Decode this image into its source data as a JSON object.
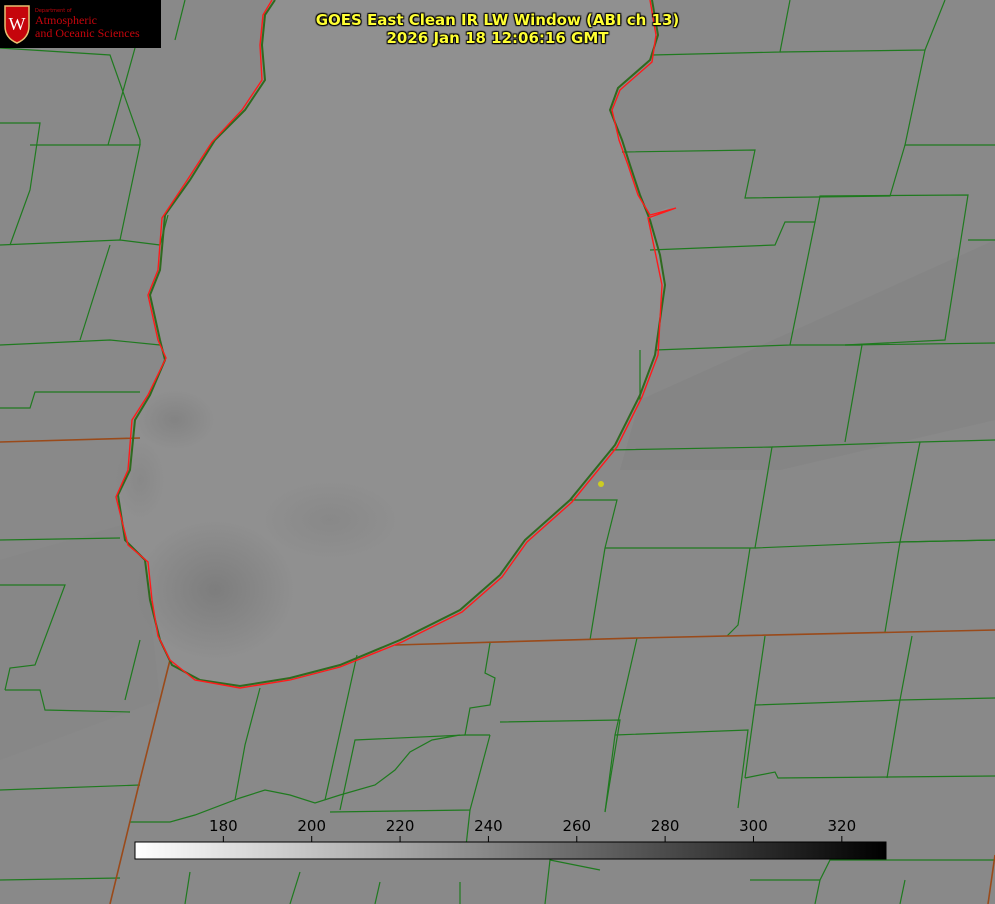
{
  "title": {
    "line1": "GOES East Clean IR LW Window (ABI ch 13)",
    "line2": "2026 Jan 18 12:06:16 GMT"
  },
  "logo": {
    "dept": "Department of",
    "line1": "Atmospheric",
    "line2": "and Oceanic Sciences",
    "seal_letter": "W"
  },
  "colorbar": {
    "min": 160,
    "max": 330,
    "ticks": [
      180,
      200,
      220,
      240,
      260,
      280,
      300,
      320
    ],
    "start_color": "#ffffff",
    "end_color": "#000000"
  },
  "colors": {
    "land": "#898989",
    "lake": "#909090",
    "county_lines": "#1f7a1f",
    "state_lines": "#9a4a1a",
    "coastline": "#ff1a1a",
    "title": "#ffff33",
    "logo_red": "#c5050c",
    "marker": "#cccc22"
  }
}
